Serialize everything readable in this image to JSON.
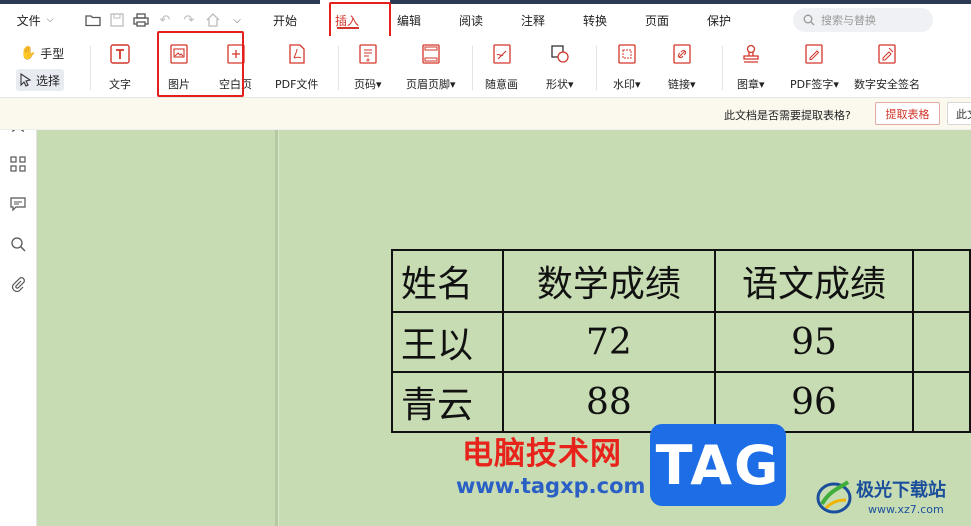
{
  "menubar": {
    "file_label": "文件",
    "tabs": [
      {
        "label": "开始"
      },
      {
        "label": "插入"
      },
      {
        "label": "编辑"
      },
      {
        "label": "阅读"
      },
      {
        "label": "注释"
      },
      {
        "label": "转换"
      },
      {
        "label": "页面"
      },
      {
        "label": "保护"
      }
    ],
    "active_tab": "插入",
    "search_placeholder": "搜索与替换"
  },
  "ribbon": {
    "hand_tool": "手型",
    "select_tool": "选择",
    "buttons": [
      {
        "label": "文字"
      },
      {
        "label": "图片"
      },
      {
        "label": "空白页"
      },
      {
        "label": "PDF文件"
      },
      {
        "label": "页码▾"
      },
      {
        "label": "页眉页脚▾"
      },
      {
        "label": "随意画"
      },
      {
        "label": "形状▾"
      },
      {
        "label": "水印▾"
      },
      {
        "label": "链接▾"
      },
      {
        "label": "图章▾"
      },
      {
        "label": "PDF签字▾"
      },
      {
        "label": "数字安全签名"
      }
    ]
  },
  "notice": {
    "text": "此文档是否需要提取表格?",
    "extract_button": "提取表格",
    "secondary_button": "此文"
  },
  "table": {
    "headers": [
      "姓名",
      "数学成绩",
      "语文成绩"
    ],
    "rows": [
      {
        "name": "王以",
        "math": "72",
        "chinese": "95"
      },
      {
        "name": "青云",
        "math": "88",
        "chinese": "96"
      }
    ]
  },
  "watermark": {
    "site_name": "电脑技术网",
    "site_url": "www.tagxp.com",
    "tag": "TAG",
    "brand_name": "极光下载站",
    "brand_url": "www.xz7.com"
  },
  "colors": {
    "accent": "#d2362a",
    "highlight_box": "#e3201b",
    "document_bg": "#c7dcb3",
    "notice_bg": "#fbf8ee"
  }
}
